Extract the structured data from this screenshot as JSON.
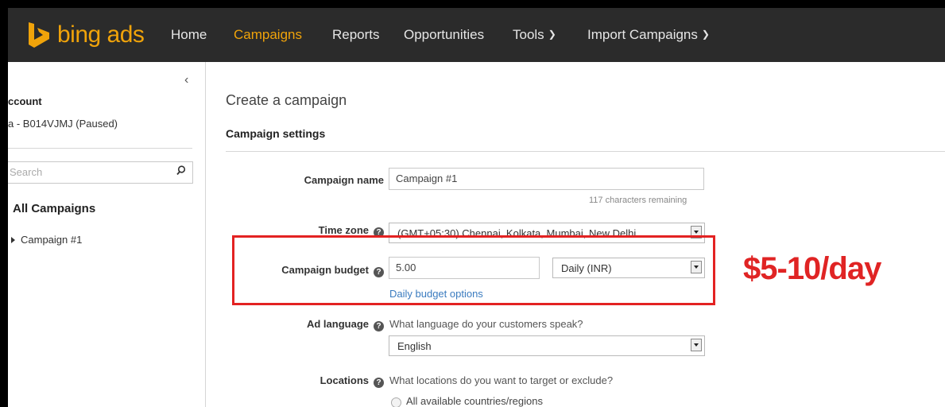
{
  "nav": {
    "logo_text": "bing ads",
    "items": [
      {
        "label": "Home"
      },
      {
        "label": "Campaigns"
      },
      {
        "label": "Reports"
      },
      {
        "label": "Opportunities"
      },
      {
        "label": "Tools"
      },
      {
        "label": "Import Campaigns"
      }
    ],
    "active": "Campaigns",
    "colors": {
      "bar": "#2b2b2b",
      "accent": "#f0a30a",
      "text": "#e6e6e6"
    }
  },
  "sidebar": {
    "account_heading": "ccount",
    "account_name": "a - B014VJMJ (Paused)",
    "search_placeholder": "Search",
    "all_campaigns": "All Campaigns",
    "campaigns": [
      "Campaign #1"
    ],
    "icons": {
      "collapse": "chevron-left-icon",
      "search": "search-icon",
      "expand": "caret-right-icon"
    }
  },
  "main": {
    "page_title": "Create a campaign",
    "section_title": "Campaign settings",
    "campaign_name": {
      "label": "Campaign name",
      "value": "Campaign #1",
      "hint": "117 characters remaining"
    },
    "time_zone": {
      "label": "Time zone",
      "value": "(GMT+05:30) Chennai, Kolkata, Mumbai, New Delhi"
    },
    "campaign_budget": {
      "label": "Campaign budget",
      "value": "5.00",
      "type": "Daily (INR)",
      "link": "Daily budget options"
    },
    "ad_language": {
      "label": "Ad language",
      "question": "What language do your customers speak?",
      "value": "English"
    },
    "locations": {
      "label": "Locations",
      "question": "What locations do you want to target or exclude?",
      "option": "All available countries/regions"
    },
    "help_icon": "question-circle-icon"
  },
  "annotation": {
    "text": "$5-10/day",
    "color": "#e02424"
  }
}
